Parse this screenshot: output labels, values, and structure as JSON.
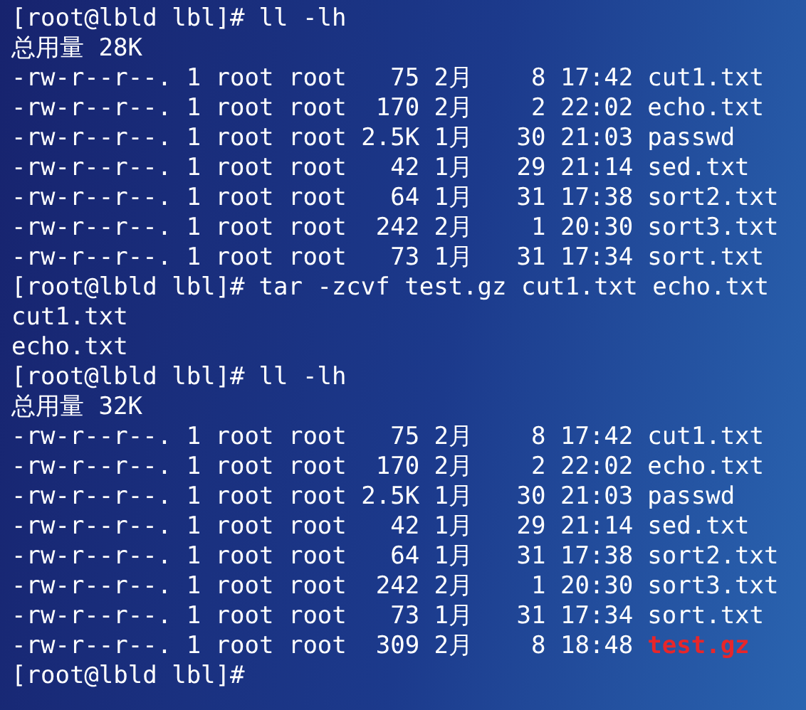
{
  "lines": [
    {
      "kind": "prompt",
      "prompt": "[root@lbld lbl]#",
      "command": "ll -lh"
    },
    {
      "kind": "output",
      "text": "总用量 28K"
    },
    {
      "kind": "listing",
      "meta": "-rw-r--r--. 1 root root   75 2月    8 17:42",
      "name": "cut1.txt",
      "color": "#ffffff"
    },
    {
      "kind": "listing",
      "meta": "-rw-r--r--. 1 root root  170 2月    2 22:02",
      "name": "echo.txt",
      "color": "#ffffff"
    },
    {
      "kind": "listing",
      "meta": "-rw-r--r--. 1 root root 2.5K 1月   30 21:03",
      "name": "passwd",
      "color": "#ffffff"
    },
    {
      "kind": "listing",
      "meta": "-rw-r--r--. 1 root root   42 1月   29 21:14",
      "name": "sed.txt",
      "color": "#ffffff"
    },
    {
      "kind": "listing",
      "meta": "-rw-r--r--. 1 root root   64 1月   31 17:38",
      "name": "sort2.txt",
      "color": "#ffffff"
    },
    {
      "kind": "listing",
      "meta": "-rw-r--r--. 1 root root  242 2月    1 20:30",
      "name": "sort3.txt",
      "color": "#ffffff"
    },
    {
      "kind": "listing",
      "meta": "-rw-r--r--. 1 root root   73 1月   31 17:34",
      "name": "sort.txt",
      "color": "#ffffff"
    },
    {
      "kind": "prompt",
      "prompt": "[root@lbld lbl]#",
      "command": "tar -zcvf test.gz cut1.txt echo.txt"
    },
    {
      "kind": "output",
      "text": "cut1.txt"
    },
    {
      "kind": "output",
      "text": "echo.txt"
    },
    {
      "kind": "prompt",
      "prompt": "[root@lbld lbl]#",
      "command": "ll -lh"
    },
    {
      "kind": "output",
      "text": "总用量 32K"
    },
    {
      "kind": "listing",
      "meta": "-rw-r--r--. 1 root root   75 2月    8 17:42",
      "name": "cut1.txt",
      "color": "#ffffff"
    },
    {
      "kind": "listing",
      "meta": "-rw-r--r--. 1 root root  170 2月    2 22:02",
      "name": "echo.txt",
      "color": "#ffffff"
    },
    {
      "kind": "listing",
      "meta": "-rw-r--r--. 1 root root 2.5K 1月   30 21:03",
      "name": "passwd",
      "color": "#ffffff"
    },
    {
      "kind": "listing",
      "meta": "-rw-r--r--. 1 root root   42 1月   29 21:14",
      "name": "sed.txt",
      "color": "#ffffff"
    },
    {
      "kind": "listing",
      "meta": "-rw-r--r--. 1 root root   64 1月   31 17:38",
      "name": "sort2.txt",
      "color": "#ffffff"
    },
    {
      "kind": "listing",
      "meta": "-rw-r--r--. 1 root root  242 2月    1 20:30",
      "name": "sort3.txt",
      "color": "#ffffff"
    },
    {
      "kind": "listing",
      "meta": "-rw-r--r--. 1 root root   73 1月   31 17:34",
      "name": "sort.txt",
      "color": "#ffffff"
    },
    {
      "kind": "listing",
      "meta": "-rw-r--r--. 1 root root  309 2月    8 18:48",
      "name": "test.gz",
      "color": "#e8262a"
    },
    {
      "kind": "prompt",
      "prompt": "[root@lbld lbl]#"
    }
  ]
}
